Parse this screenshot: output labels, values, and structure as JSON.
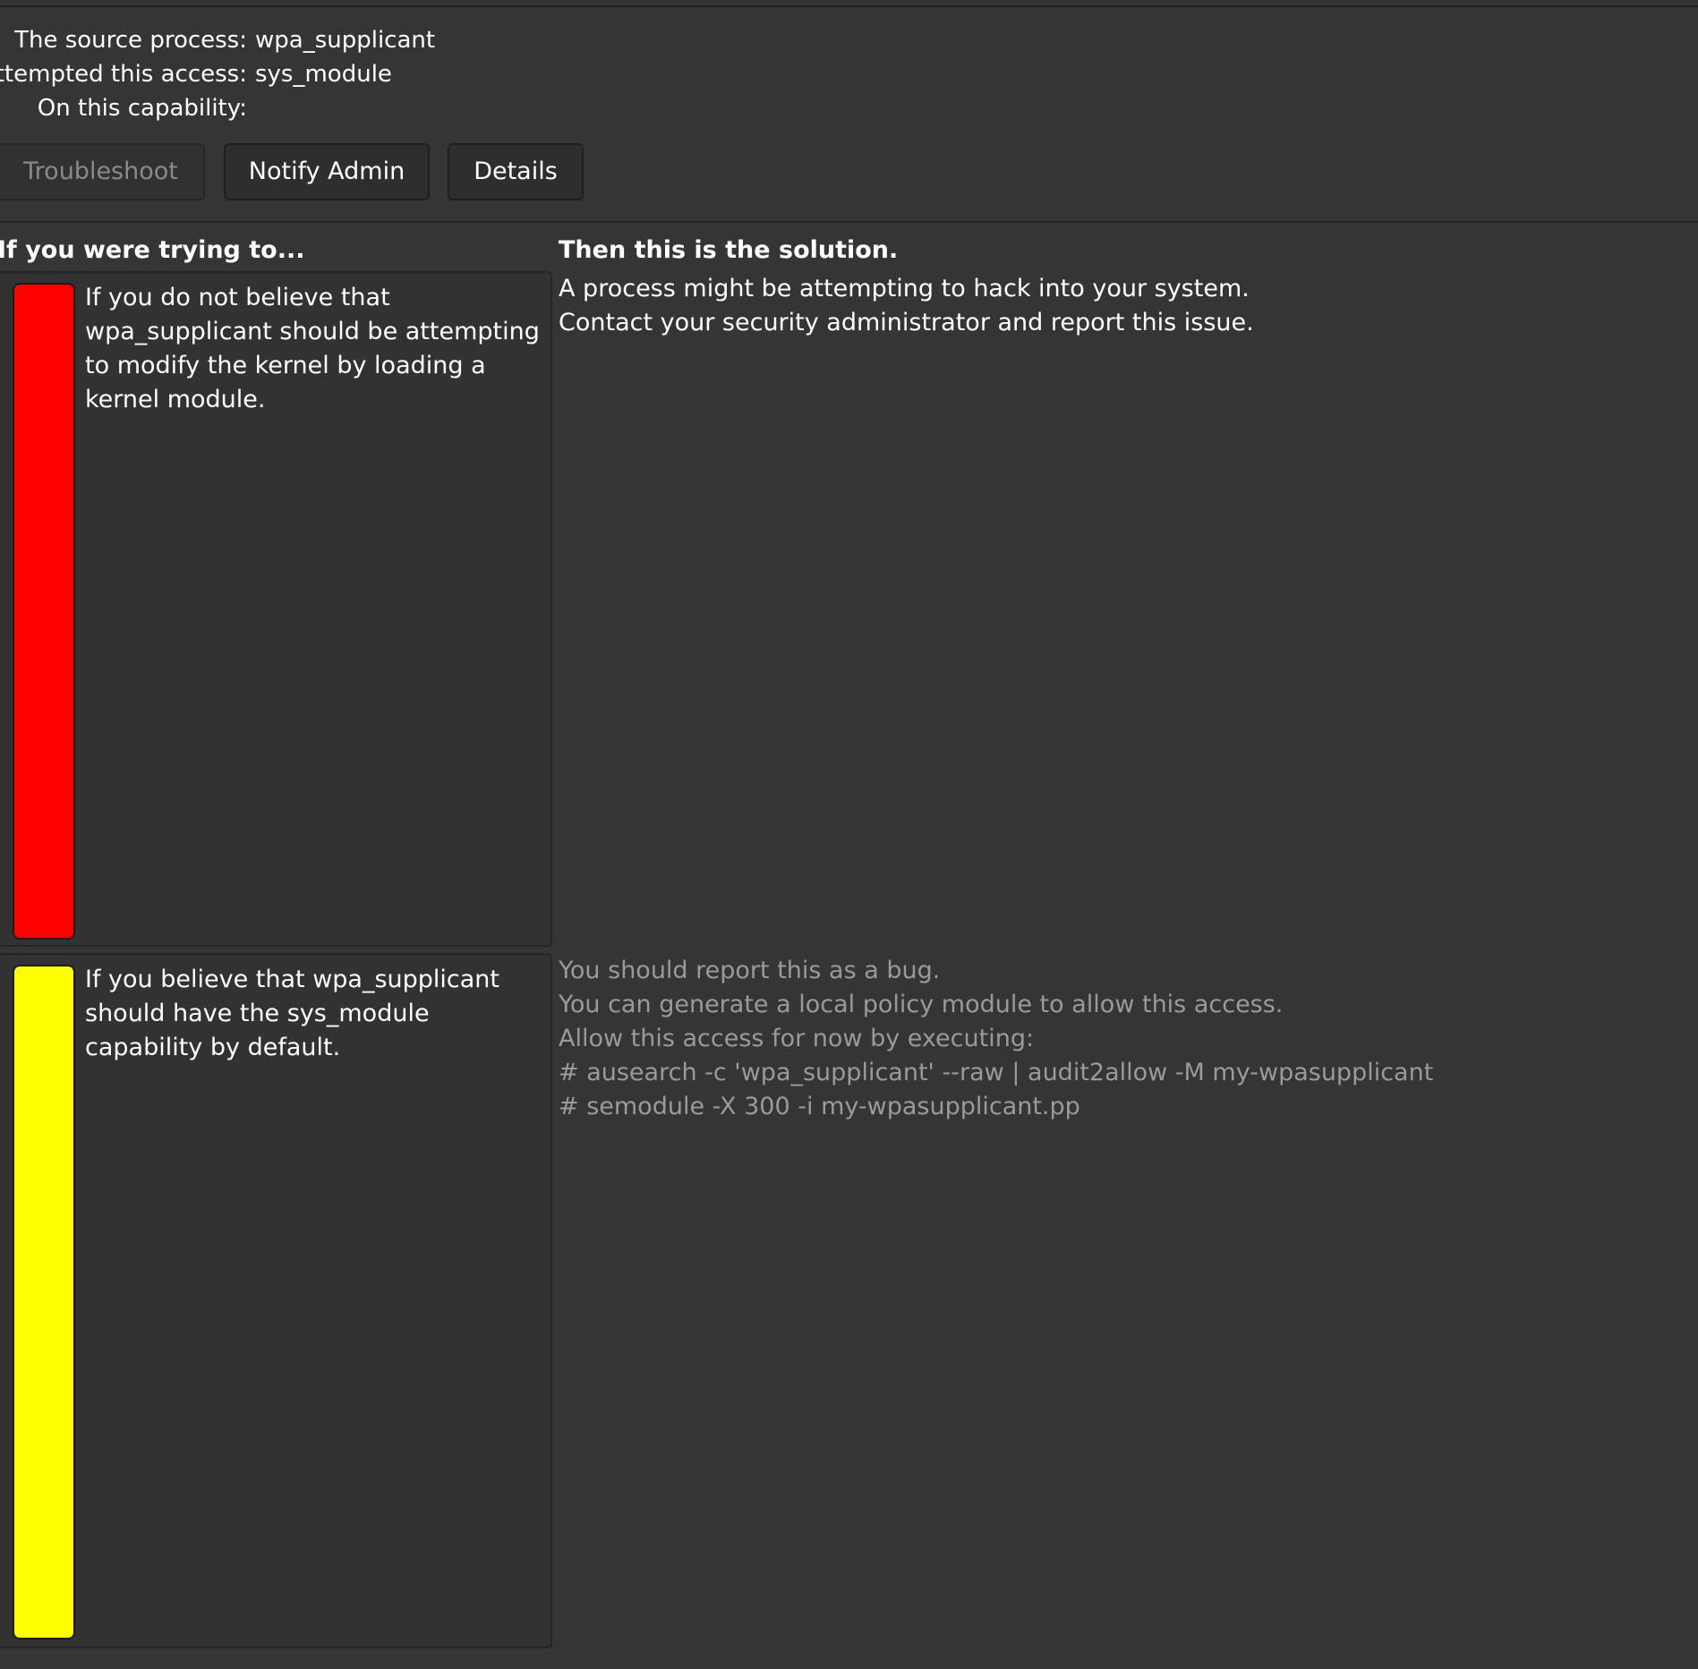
{
  "info": {
    "source_process_label": "The source process:",
    "source_process_value": "wpa_supplicant",
    "access_label": "Attempted this access:",
    "access_value": "sys_module",
    "capability_label": "On this capability:",
    "capability_value": ""
  },
  "buttons": {
    "troubleshoot": "Troubleshoot",
    "notify_admin": "Notify Admin",
    "details": "Details"
  },
  "columns": {
    "trying": "If you were trying to...",
    "solution": "Then this is the solution."
  },
  "colors": {
    "red_bar": "#ff0000",
    "yellow_bar": "#ffff00"
  },
  "plugins": [
    {
      "if_text": "If you do not believe that wpa_supplicant should be attempting to modify the kernel by loading a kernel module.",
      "solution_lines": [
        "A process might be attempting to hack into your system.",
        "Contact your security administrator and report this issue."
      ]
    },
    {
      "if_text": "If you believe that wpa_supplicant should have the sys_module capability by default.",
      "solution_lines": [
        "You should report this as a bug.",
        "You can generate a local policy module to allow this access.",
        "Allow this access for now by executing:",
        "# ausearch -c 'wpa_supplicant' --raw | audit2allow -M my-wpasupplicant",
        "# semodule -X 300 -i my-wpasupplicant.pp"
      ]
    }
  ]
}
